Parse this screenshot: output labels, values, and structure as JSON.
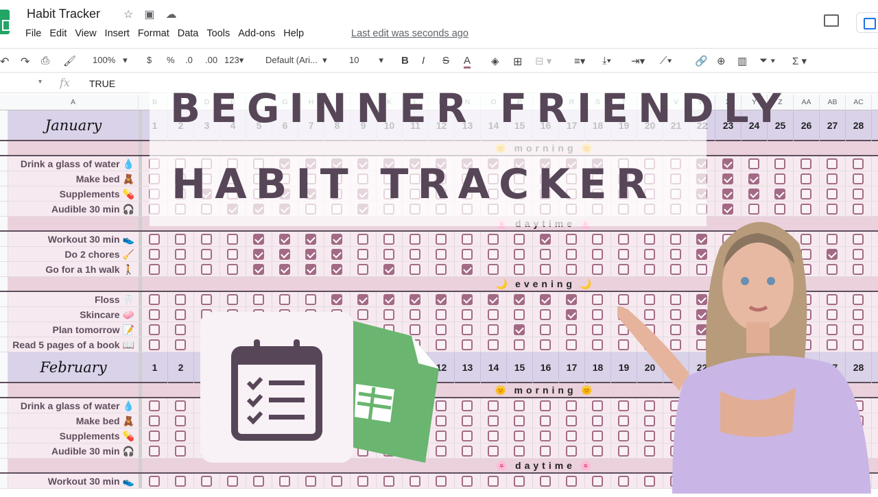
{
  "app": {
    "title": "Habit Tracker",
    "last_edit": "Last edit was seconds ago",
    "menu": [
      "File",
      "Edit",
      "View",
      "Insert",
      "Format",
      "Data",
      "Tools",
      "Add-ons",
      "Help"
    ],
    "title_icons": [
      "star-icon",
      "move-to-folder-icon",
      "cloud-saved-icon"
    ]
  },
  "toolbar": {
    "zoom": "100%",
    "currency": "$",
    "percent": "%",
    "decrease_decimals": ".0",
    "increase_decimals": ".00",
    "more_formats": "123",
    "font": "Default (Ari...",
    "font_size": "10",
    "bold": "B",
    "italic": "I",
    "strikethrough": "S",
    "text_color": "A"
  },
  "formula_bar": {
    "fx": "fx",
    "value": "TRUE"
  },
  "columns": [
    "A",
    "B",
    "C",
    "D",
    "E",
    "F",
    "G",
    "H",
    "I",
    "J",
    "K",
    "L",
    "M",
    "N",
    "O",
    "P",
    "Q",
    "R",
    "S",
    "T",
    "U",
    "V",
    "W",
    "X",
    "Y",
    "Z",
    "AA",
    "AB",
    "AC"
  ],
  "months": [
    {
      "name": "January",
      "days": [
        1,
        2,
        3,
        4,
        5,
        6,
        7,
        8,
        9,
        10,
        11,
        12,
        13,
        14,
        15,
        16,
        17,
        18,
        19,
        20,
        21,
        22,
        23,
        24,
        25,
        26,
        27,
        28
      ],
      "sections": [
        {
          "label": "morning",
          "emoji": "🌞",
          "habits": [
            {
              "label": "Drink a glass of water",
              "emoji": "💧",
              "checked": [
                6,
                7,
                8,
                9,
                10,
                11,
                12,
                13,
                14,
                15,
                16,
                17,
                18,
                22,
                23
              ]
            },
            {
              "label": "Make bed",
              "emoji": "🧸",
              "checked": [
                22,
                23,
                24
              ]
            },
            {
              "label": "Supplements",
              "emoji": "💊",
              "checked": [
                3,
                6,
                7,
                9,
                22,
                23,
                24,
                25
              ]
            },
            {
              "label": "Audible 30 min",
              "emoji": "🎧",
              "checked": [
                4,
                5,
                6,
                9,
                23
              ]
            }
          ]
        },
        {
          "label": "daytime",
          "emoji": "🌸",
          "habits": [
            {
              "label": "Workout 30 min",
              "emoji": "👟",
              "checked": [
                5,
                6,
                7,
                8,
                16,
                22
              ]
            },
            {
              "label": "Do 2 chores",
              "emoji": "🧹",
              "checked": [
                5,
                6,
                7,
                8,
                22,
                23,
                27
              ]
            },
            {
              "label": "Go for a 1h walk",
              "emoji": "🚶",
              "checked": [
                5,
                6,
                7,
                8,
                10,
                13,
                23
              ]
            }
          ]
        },
        {
          "label": "evening",
          "emoji": "🌙",
          "habits": [
            {
              "label": "Floss",
              "emoji": "🦷",
              "checked": [
                8,
                9,
                10,
                11,
                12,
                13,
                14,
                15,
                16,
                17,
                22,
                23
              ]
            },
            {
              "label": "Skincare",
              "emoji": "🧼",
              "checked": [
                17,
                22,
                23
              ]
            },
            {
              "label": "Plan tomorrow",
              "emoji": "📝",
              "checked": [
                15,
                22
              ]
            },
            {
              "label": "Read 5 pages of a book",
              "emoji": "📖",
              "checked": []
            }
          ]
        }
      ]
    },
    {
      "name": "February",
      "days": [
        1,
        2,
        3,
        4,
        5,
        6,
        7,
        8,
        9,
        10,
        11,
        12,
        13,
        14,
        15,
        16,
        17,
        18,
        19,
        20,
        21,
        22,
        23,
        24,
        25,
        26,
        27,
        28
      ],
      "sections": [
        {
          "label": "morning",
          "emoji": "🌞",
          "habits": [
            {
              "label": "Drink a glass of water",
              "emoji": "💧",
              "checked": []
            },
            {
              "label": "Make bed",
              "emoji": "🧸",
              "checked": []
            },
            {
              "label": "Supplements",
              "emoji": "💊",
              "checked": []
            },
            {
              "label": "Audible 30 min",
              "emoji": "🎧",
              "checked": []
            }
          ]
        },
        {
          "label": "daytime",
          "emoji": "🌸",
          "habits": [
            {
              "label": "Workout 30 min",
              "emoji": "👟",
              "checked": []
            }
          ]
        }
      ]
    }
  ],
  "overlay": {
    "line1": "BEGINNER FRIENDLY",
    "line2": "HABIT TRACKER"
  },
  "colors": {
    "month_header": "#d9d2e9",
    "section_row": "#ead1dc",
    "habit_row": "#f6eaf0",
    "checkbox": "#a36a85",
    "overlay_text": "#574658",
    "sheets_green": "#6ab56f"
  }
}
